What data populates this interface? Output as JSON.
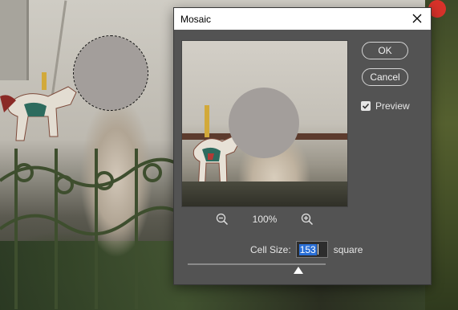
{
  "dialog": {
    "title": "Mosaic",
    "ok_label": "OK",
    "cancel_label": "Cancel",
    "preview_label": "Preview",
    "preview_checked": true,
    "zoom_percent": "100%",
    "cell_size_label": "Cell Size:",
    "cell_size_value": "153",
    "cell_size_unit": "square",
    "slider_fraction": 0.8
  },
  "icons": {
    "close": "close-icon",
    "zoom_out": "zoom-out-icon",
    "zoom_in": "zoom-in-icon",
    "check": "checkmark-icon"
  },
  "colors": {
    "dialog_bg": "#535353",
    "title_bg": "#ffffff",
    "selection": "#2a6fd6",
    "mosaic_gray": "#a39e9b"
  }
}
